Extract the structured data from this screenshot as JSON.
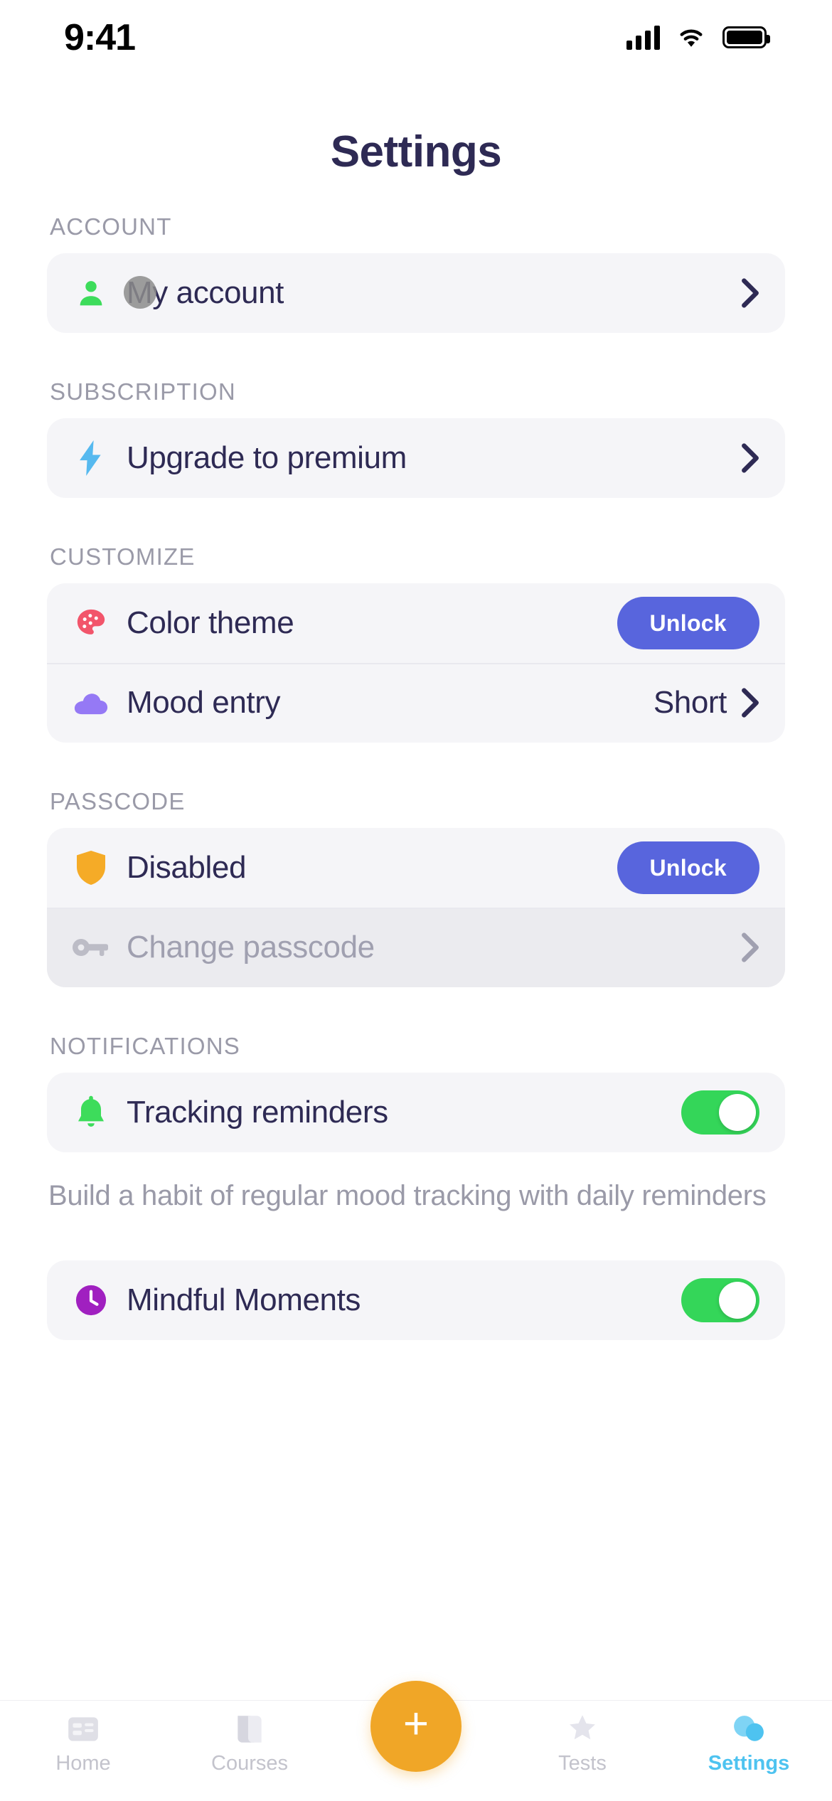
{
  "status_bar": {
    "time": "9:41",
    "signal_icon": "cellular-signal-icon",
    "wifi_icon": "wifi-icon",
    "battery_icon": "battery-icon"
  },
  "header": {
    "title": "Settings"
  },
  "sections": [
    {
      "label": "ACCOUNT",
      "rows": [
        {
          "icon": "person-icon",
          "label": "My account",
          "accessory": "chevron",
          "color": "#3ddc5b"
        }
      ]
    },
    {
      "label": "SUBSCRIPTION",
      "rows": [
        {
          "icon": "lightning-bolt-icon",
          "label": "Upgrade to premium",
          "accessory": "chevron",
          "color": "#56b9ef"
        }
      ]
    },
    {
      "label": "CUSTOMIZE",
      "rows": [
        {
          "icon": "palette-icon",
          "label": "Color theme",
          "accessory": "button",
          "button_label": "Unlock",
          "color": "#f2556b"
        },
        {
          "icon": "cloud-icon",
          "label": "Mood entry",
          "accessory": "chevron",
          "value": "Short",
          "color": "#9579f5"
        }
      ]
    },
    {
      "label": "PASSCODE",
      "rows": [
        {
          "icon": "shield-icon",
          "label": "Disabled",
          "accessory": "button",
          "button_label": "Unlock",
          "color": "#f5ab27"
        },
        {
          "icon": "key-icon",
          "label": "Change passcode",
          "accessory": "chevron",
          "disabled": true,
          "color": "#bcbcc6"
        }
      ]
    },
    {
      "label": "NOTIFICATIONS",
      "rows": [
        {
          "icon": "bell-icon",
          "label": "Tracking reminders",
          "accessory": "toggle",
          "toggle_on": true,
          "color": "#3ddc5b"
        }
      ],
      "helper_text": "Build a habit of regular mood tracking with daily reminders"
    },
    {
      "label": "",
      "rows": [
        {
          "icon": "clock-icon",
          "label": "Mindful Moments",
          "accessory": "toggle",
          "toggle_on": true,
          "color": "#a020c0"
        }
      ]
    }
  ],
  "tab_bar": {
    "tabs": [
      {
        "label": "Home",
        "icon": "home-icon",
        "active": false
      },
      {
        "label": "Courses",
        "icon": "courses-icon",
        "active": false
      },
      {
        "label": "Tests",
        "icon": "tests-icon",
        "active": false
      },
      {
        "label": "Settings",
        "icon": "settings-icon",
        "active": true
      }
    ],
    "add_button_label": "+",
    "add_button_icon": "plus-icon"
  },
  "colors": {
    "accent_button": "#5865dd",
    "fab": "#f0a627",
    "active_tab": "#4ec3f0",
    "toggle_on": "#34d659",
    "title": "#2e2a54",
    "section_label": "#9a9aa8",
    "card_bg": "#f5f5f8"
  }
}
